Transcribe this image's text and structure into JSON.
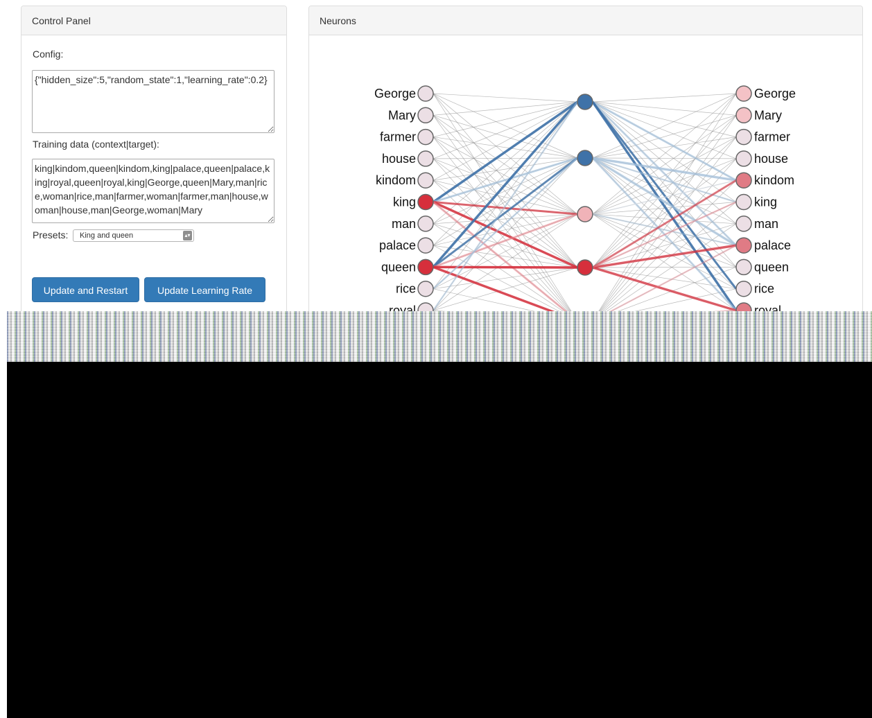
{
  "control_panel": {
    "title": "Control Panel",
    "config_label": "Config:",
    "config_value": "{\"hidden_size\":5,\"random_state\":1,\"learning_rate\":0.2}",
    "training_label": "Training data (context|target):",
    "training_value": "king|kindom,queen|kindom,king|palace,queen|palace,king|royal,queen|royal,king|George,queen|Mary,man|rice,woman|rice,man|farmer,woman|farmer,man|house,woman|house,man|George,woman|Mary",
    "presets_label": "Presets:",
    "preset_selected": "King and queen",
    "update_restart_label": "Update and Restart",
    "update_lr_label": "Update Learning Rate"
  },
  "neurons_panel": {
    "title": "Neurons",
    "input_words": [
      "George",
      "Mary",
      "farmer",
      "house",
      "kindom",
      "king",
      "man",
      "palace",
      "queen",
      "rice",
      "royal"
    ],
    "output_words": [
      "George",
      "Mary",
      "farmer",
      "house",
      "kindom",
      "king",
      "man",
      "palace",
      "queen",
      "rice",
      "royal"
    ],
    "input_colors": [
      "#ecdfe5",
      "#ecdfe5",
      "#ecdfe5",
      "#ecdfe5",
      "#ecdfe5",
      "#d62f3c",
      "#ecdfe5",
      "#ecdfe5",
      "#d62f3c",
      "#ecdfe5",
      "#ecdfe5"
    ],
    "hidden_colors": [
      "#3f72a8",
      "#3f72a8",
      "#f0b3b8",
      "#d62f3c"
    ],
    "output_colors": [
      "#f4c2c6",
      "#f4c2c6",
      "#ecdfe5",
      "#ecdfe5",
      "#e07b85",
      "#ecdfe5",
      "#ecdfe5",
      "#e07b85",
      "#ecdfe5",
      "#ecdfe5",
      "#e07b85"
    ]
  }
}
